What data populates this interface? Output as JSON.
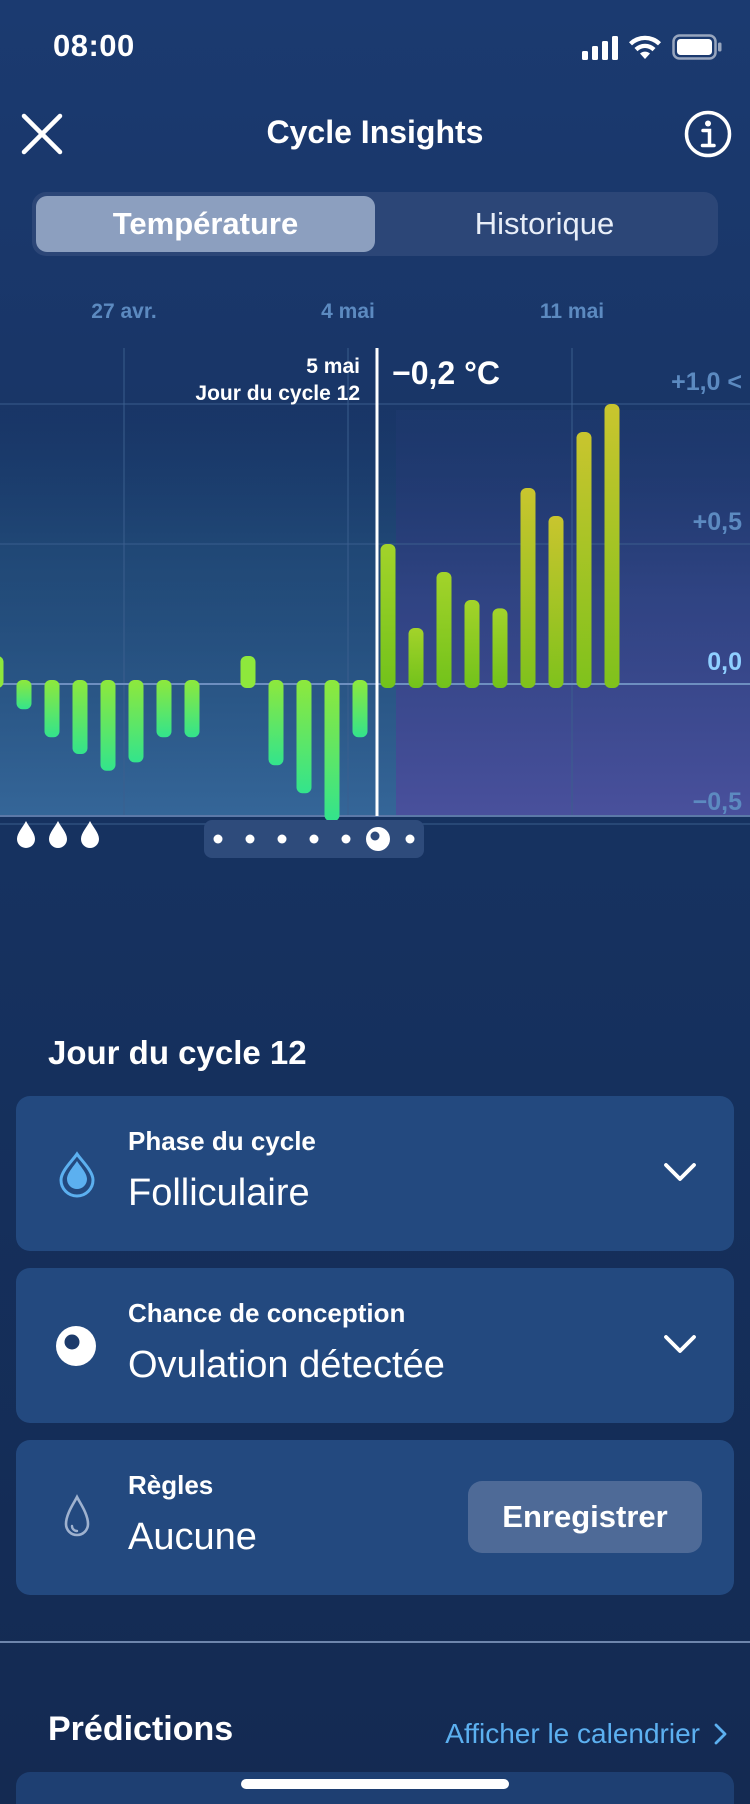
{
  "status_bar": {
    "time": "08:00"
  },
  "header": {
    "title": "Cycle Insights"
  },
  "tabs": [
    {
      "label": "Température",
      "active": true
    },
    {
      "label": "Historique",
      "active": false
    }
  ],
  "chart_data": {
    "type": "bar",
    "x_tick_labels": [
      "27 avr.",
      "4 mai",
      "11 mai"
    ],
    "y_tick_labels": [
      "+1,0 <",
      "+0,5",
      "0,0",
      "−0,5"
    ],
    "values": [
      0.1,
      -0.09,
      -0.19,
      -0.25,
      -0.31,
      -0.28,
      -0.19,
      -0.19,
      null,
      0.1,
      -0.29,
      -0.39,
      -0.49,
      -0.19,
      0.5,
      0.2,
      0.4,
      0.3,
      0.27,
      0.7,
      0.6,
      0.9,
      1.0
    ],
    "ylim": [
      -0.9,
      1.2
    ],
    "selected": {
      "date": "5 mai",
      "cycle_day": "Jour du cycle 12",
      "value": "−0,2 °C"
    },
    "legend": {
      "drops": 3,
      "page_dots": 7,
      "active_page": 6
    },
    "colors": {
      "low": "#3de68a",
      "high": "#9ad81c",
      "late": "#c2c82a"
    }
  },
  "cycle_day_title": "Jour du cycle 12",
  "cards": {
    "phase": {
      "label": "Phase du cycle",
      "value": "Folliculaire"
    },
    "conception": {
      "label": "Chance de conception",
      "value": "Ovulation détectée"
    },
    "period": {
      "label": "Règles",
      "value": "Aucune",
      "button": "Enregistrer"
    }
  },
  "predictions": {
    "title": "Prédictions",
    "link": "Afficher le calendrier"
  }
}
